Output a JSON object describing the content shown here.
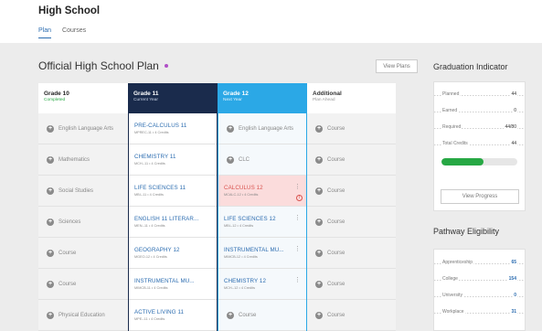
{
  "header": {
    "title": "High School"
  },
  "tabs": [
    {
      "label": "Plan"
    },
    {
      "label": "Courses"
    }
  ],
  "plan": {
    "title": "Official High School Plan",
    "view_plans_label": "View Plans",
    "dot_color": "#b04fc7"
  },
  "columns": [
    {
      "title": "Grade 10",
      "subtitle": "Completed",
      "rows": [
        {
          "type": "empty",
          "label": "English Language Arts"
        },
        {
          "type": "empty",
          "label": "Mathematics"
        },
        {
          "type": "empty",
          "label": "Social Studies"
        },
        {
          "type": "empty",
          "label": "Sciences"
        },
        {
          "type": "empty",
          "label": "Course"
        },
        {
          "type": "empty",
          "label": "Course"
        },
        {
          "type": "empty",
          "label": "Physical Education"
        }
      ]
    },
    {
      "title": "Grade 11",
      "subtitle": "Current Year",
      "rows": [
        {
          "type": "course",
          "name": "PRE-CALCULUS 11",
          "detail": "MPREC-11 • 4 Credits"
        },
        {
          "type": "course",
          "name": "CHEMISTRY 11",
          "detail": "MCH--11 • 4 Credits"
        },
        {
          "type": "course",
          "name": "LIFE SCIENCES 11",
          "detail": "MBI--11 • 4 Credits"
        },
        {
          "type": "course",
          "name": "ENGLISH 11 LITERAR...",
          "detail": "MEN--11 • 4 Credits"
        },
        {
          "type": "course",
          "name": "GEOGRAPHY 12",
          "detail": "MGEO-12 • 4 Credits"
        },
        {
          "type": "course",
          "name": "INSTRUMENTAL MU...",
          "detail": "MIMCB-11 • 4 Credits"
        },
        {
          "type": "course",
          "name": "ACTIVE LIVING 11",
          "detail": "MPE--11 • 4 Credits"
        }
      ]
    },
    {
      "title": "Grade 12",
      "subtitle": "Next Year",
      "rows": [
        {
          "type": "empty",
          "label": "English Language Arts"
        },
        {
          "type": "empty",
          "label": "CLC"
        },
        {
          "type": "course",
          "name": "CALCULUS 12",
          "detail": "MCALC-12 • 4 Credits",
          "alert": true
        },
        {
          "type": "course",
          "name": "LIFE SCIENCES 12",
          "detail": "MBI--12 • 4 Credits"
        },
        {
          "type": "course",
          "name": "INSTRUMENTAL MU...",
          "detail": "MIMCB-12 • 4 Credits"
        },
        {
          "type": "course",
          "name": "CHEMISTRY 12",
          "detail": "MCH--12 • 4 Credits"
        },
        {
          "type": "empty",
          "label": "Course"
        }
      ]
    },
    {
      "title": "Additional",
      "subtitle": "Plan Ahead",
      "rows": [
        {
          "type": "empty",
          "label": "Course"
        },
        {
          "type": "empty",
          "label": "Course"
        },
        {
          "type": "empty",
          "label": "Course"
        },
        {
          "type": "empty",
          "label": "Course"
        },
        {
          "type": "empty",
          "label": "Course"
        },
        {
          "type": "empty",
          "label": "Course"
        },
        {
          "type": "empty",
          "label": "Course"
        }
      ]
    }
  ],
  "graduation": {
    "title": "Graduation Indicator",
    "stats": [
      {
        "label": "Planned",
        "value": "44"
      },
      {
        "label": "Earned",
        "value": "0"
      },
      {
        "label": "Required",
        "value": "44/80"
      },
      {
        "label": "Total Credits",
        "value": "44"
      }
    ],
    "progress_fraction": 0.55,
    "progress_color": "#27a844",
    "view_progress_label": "View Progress"
  },
  "pathway": {
    "title": "Pathway Eligibility",
    "items": [
      {
        "label": "Apprenticeship",
        "value": "65"
      },
      {
        "label": "College",
        "value": "154"
      },
      {
        "label": "University",
        "value": "0"
      },
      {
        "label": "Workplace",
        "value": "31"
      }
    ]
  },
  "icons": {
    "add": "plus-circle-icon",
    "menu": "vertical-dots-icon",
    "warning": "alert-circle-icon"
  }
}
